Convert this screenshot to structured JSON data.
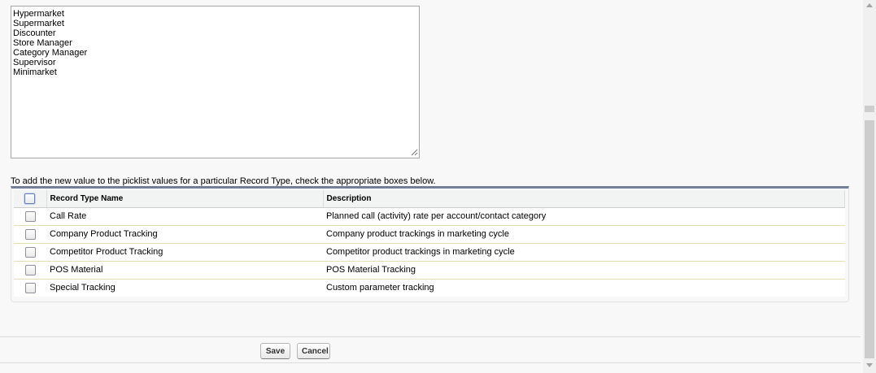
{
  "picklist": {
    "value": "Hypermarket\nSupermarket\nDiscounter\nStore Manager\nCategory Manager\nSupervisor\nMinimarket"
  },
  "instructions": "To add the new value to the picklist values for a particular Record Type, check the appropriate boxes below.",
  "record_types": {
    "headers": {
      "name": "Record Type Name",
      "description": "Description"
    },
    "rows": [
      {
        "name": "Call Rate",
        "description": "Planned call (activity) rate per account/contact category"
      },
      {
        "name": "Company Product Tracking",
        "description": "Company product trackings in marketing cycle"
      },
      {
        "name": "Competitor Product Tracking",
        "description": "Competitor product trackings in marketing cycle"
      },
      {
        "name": "POS Material",
        "description": "POS Material Tracking"
      },
      {
        "name": "Special Tracking",
        "description": "Custom parameter tracking"
      }
    ]
  },
  "buttons": {
    "save": "Save",
    "cancel": "Cancel"
  }
}
